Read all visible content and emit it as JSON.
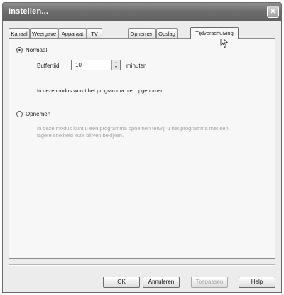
{
  "window": {
    "title": "Instellen...",
    "close_glyph": "✕"
  },
  "tabs": [
    {
      "label": "Kanaal",
      "active": false
    },
    {
      "label": "Weergave",
      "active": false
    },
    {
      "label": "Apparaat",
      "active": false
    },
    {
      "label": "TV",
      "active": false
    },
    {
      "label": "Opnemen",
      "active": false
    },
    {
      "label": "Opslag",
      "active": false
    },
    {
      "label": "Tijdverschuiving",
      "active": true
    }
  ],
  "panel": {
    "normal": {
      "label": "Normaal",
      "selected": true,
      "buffer_label": "Buffertijd:",
      "buffer_value": "10",
      "buffer_unit": "minuten",
      "description": "In deze modus wordt het programma niet opgenomen."
    },
    "record": {
      "label": "Opnemen",
      "selected": false,
      "description_line1": "In deze modus kunt u een programma opnemen terwijl u het programma met een",
      "description_line2": "lagere snelheid kunt blijven bekijken."
    }
  },
  "buttons": {
    "ok": "OK",
    "cancel": "Annuleren",
    "apply": "Toepassen",
    "help": "Help"
  },
  "icons": {
    "spin_up": "▲",
    "spin_down": "▼"
  }
}
